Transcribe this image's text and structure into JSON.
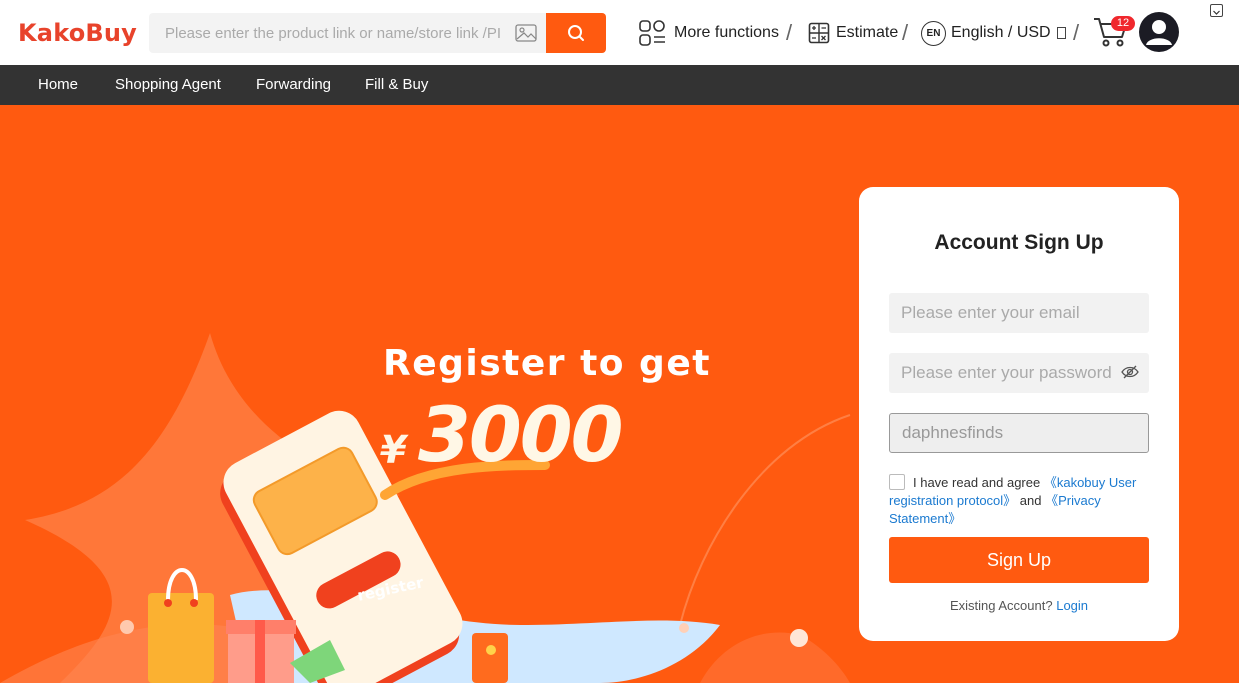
{
  "brand": {
    "logo_text": "KakoBuy",
    "accent": "#ff5a10"
  },
  "header": {
    "search_placeholder": "Please enter the product link or name/store link /PI",
    "more_functions": "More functions",
    "estimate": "Estimate",
    "lang_badge": "EN",
    "language_currency": "English / USD",
    "separator": "/",
    "cart_count": "12"
  },
  "nav": {
    "items": [
      {
        "label": "Home"
      },
      {
        "label": "Shopping Agent"
      },
      {
        "label": "Forwarding"
      },
      {
        "label": "Fill & Buy"
      }
    ]
  },
  "promo": {
    "line1": "Register to get",
    "currency": "¥",
    "amount": "3000",
    "phone_button": "register"
  },
  "signup": {
    "title": "Account Sign Up",
    "email_placeholder": "Please enter your email",
    "password_placeholder": "Please enter your password",
    "invite_code_value": "daphnesfinds",
    "agree_text": "I have read and agree",
    "protocol_link": "《kakobuy User registration protocol》",
    "and_text": "and",
    "privacy_link": "《Privacy Statement》",
    "submit_label": "Sign Up",
    "existing_text": "Existing Account?",
    "login_link": "Login"
  }
}
